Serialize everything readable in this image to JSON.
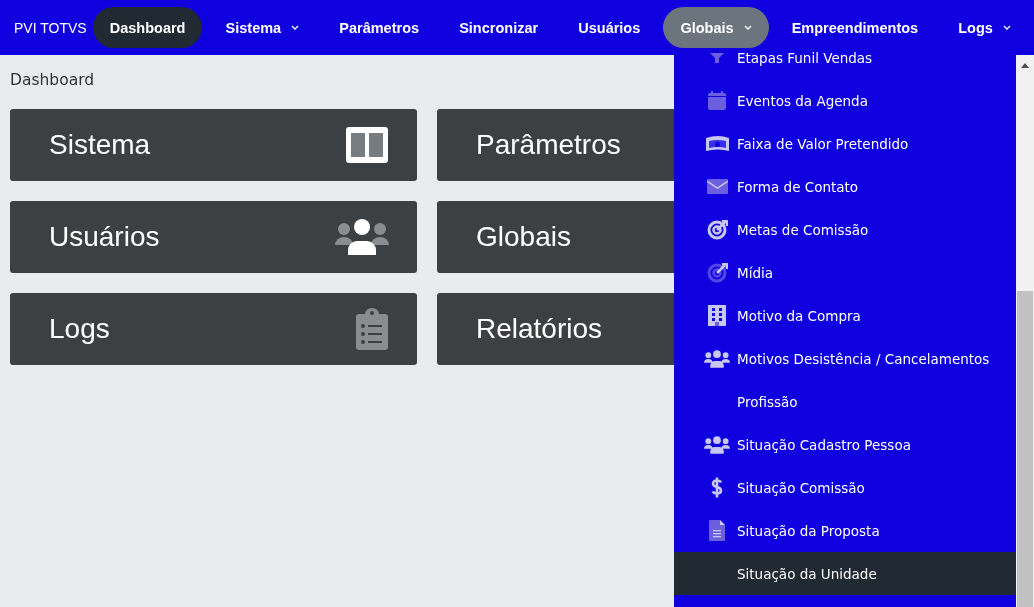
{
  "navbar": {
    "brand": "PVI TOTVS",
    "items": [
      {
        "label": "Dashboard",
        "selected": true,
        "dropdown": false
      },
      {
        "label": "Sistema",
        "selected": false,
        "dropdown": true,
        "expanded": false
      },
      {
        "label": "Parâmetros",
        "selected": false,
        "dropdown": false
      },
      {
        "label": "Sincronizar",
        "selected": false,
        "dropdown": false
      },
      {
        "label": "Usuários",
        "selected": false,
        "dropdown": false
      },
      {
        "label": "Globais",
        "selected": false,
        "dropdown": true,
        "expanded": true
      },
      {
        "label": "Empreendimentos",
        "selected": false,
        "dropdown": false
      },
      {
        "label": "Logs",
        "selected": false,
        "dropdown": true,
        "expanded": false
      }
    ]
  },
  "breadcrumb": "Dashboard",
  "cards": [
    {
      "title": "Sistema",
      "kind": "columns"
    },
    {
      "title": "Parâmetros",
      "kind": "plain"
    },
    {
      "title": "Usuários",
      "kind": "users"
    },
    {
      "title": "Globais",
      "kind": "plain"
    },
    {
      "title": "Logs",
      "kind": "clipboard"
    },
    {
      "title": "Relatórios",
      "kind": "plain"
    }
  ],
  "dropdown_menu": {
    "items": [
      {
        "label": "Etapas Funil Vendas",
        "kind": "funnel",
        "selected": false
      },
      {
        "label": "Eventos da Agenda",
        "kind": "calendar",
        "selected": false
      },
      {
        "label": "Faixa de Valor Pretendido",
        "kind": "money",
        "selected": false
      },
      {
        "label": "Forma de Contato",
        "kind": "envelope",
        "selected": false
      },
      {
        "label": "Metas de Comissão",
        "kind": "target",
        "selected": false
      },
      {
        "label": "Mídia",
        "kind": "target-dim",
        "selected": false
      },
      {
        "label": "Motivo da Compra",
        "kind": "building",
        "selected": false
      },
      {
        "label": "Motivos Desistência / Cancelamentos",
        "kind": "users",
        "selected": false
      },
      {
        "label": "Profissão",
        "kind": "plain",
        "selected": false
      },
      {
        "label": "Situação Cadastro Pessoa",
        "kind": "users",
        "selected": false
      },
      {
        "label": "Situação Comissão",
        "kind": "dollar",
        "selected": false
      },
      {
        "label": "Situação da Proposta",
        "kind": "file",
        "selected": false
      },
      {
        "label": "Situação da Unidade",
        "kind": "plain",
        "selected": true
      }
    ]
  }
}
